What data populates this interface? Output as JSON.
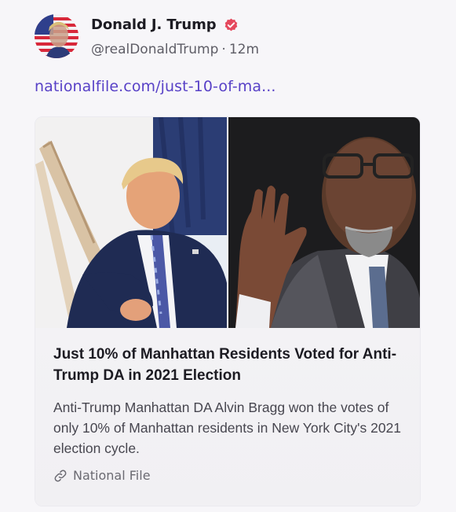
{
  "post": {
    "author": {
      "display_name": "Donald J. Trump",
      "handle": "@realDonaldTrump",
      "separator": "·",
      "time": "12m",
      "avatar_icon": "avatar-flag-portrait",
      "verified_icon": "verified-badge-icon",
      "verified_color": "#e5485d"
    },
    "link_url_text": "nationalfile.com/just-10-of-ma...",
    "link_color": "#5841c7",
    "link_card": {
      "image_icon": "article-photo-collage",
      "title": "Just 10% of Manhattan Residents Voted for Anti-Trump DA in 2021 Election",
      "description": "Anti-Trump Manhattan DA Alvin Bragg won the votes of only 10% of Manhattan residents in New York City's 2021 election cycle.",
      "source_icon": "link-icon",
      "source": "National File"
    }
  }
}
